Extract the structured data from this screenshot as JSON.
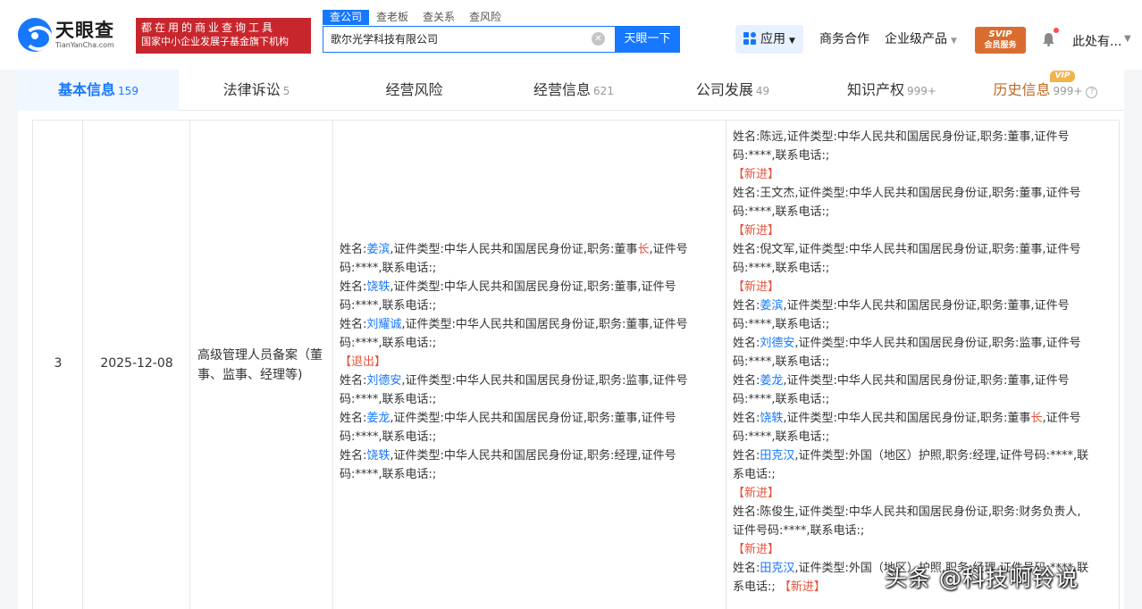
{
  "brand": {
    "name": "天眼查",
    "en": "TianYanCha.com",
    "slogan_1": "都在用的商业查询工具",
    "slogan_2": "国家中小企业发展子基金旗下机构"
  },
  "search": {
    "tabs": [
      "查公司",
      "查老板",
      "查关系",
      "查风险"
    ],
    "value": "歌尔光学科技有限公司",
    "button": "天眼一下"
  },
  "topnav": {
    "app": "应用",
    "business": "商务合作",
    "enterprise": "企业级产品",
    "svip_1": "SVIP",
    "svip_2": "会员服务",
    "user": "此处有..."
  },
  "tabs": [
    {
      "label": "基本信息",
      "count": "159"
    },
    {
      "label": "法律诉讼",
      "count": "5"
    },
    {
      "label": "经营风险",
      "count": ""
    },
    {
      "label": "经营信息",
      "count": "621"
    },
    {
      "label": "公司发展",
      "count": "49"
    },
    {
      "label": "知识产权",
      "count": "999+"
    },
    {
      "label": "历史信息",
      "count": "999+",
      "badge": "VIP"
    }
  ],
  "row": {
    "index": "3",
    "date": "2025-12-08",
    "type": "高级管理人员备案（董事、监事、经理等)"
  },
  "before": {
    "lines": [
      {
        "a": "姓名:",
        "n": "姜滨",
        "b": ",证件类型:中华人民共和国居民身份证,职务:董事",
        "h": "长",
        "c": ",证件号"
      },
      {
        "a": "码:****,联系电话:;",
        "n": "",
        "b": "",
        "h": "",
        "c": ""
      },
      {
        "a": "姓名:",
        "n": "饶轶",
        "b": ",证件类型:中华人民共和国居民身份证,职务:董事,证件号",
        "h": "",
        "c": ""
      },
      {
        "a": "码:****,联系电话:;",
        "n": "",
        "b": "",
        "h": "",
        "c": ""
      },
      {
        "a": "姓名:",
        "n": "刘耀诚",
        "b": ",证件类型:中华人民共和国居民身份证,职务:董事,证件号",
        "h": "",
        "c": ""
      },
      {
        "a": "码:****,联系电话:;",
        "n": "",
        "b": "",
        "h": "",
        "c": ""
      },
      {
        "tag": "【退出】"
      },
      {
        "a": "姓名:",
        "n": "刘德安",
        "b": ",证件类型:中华人民共和国居民身份证,职务:监事,证件号",
        "h": "",
        "c": ""
      },
      {
        "a": "码:****,联系电话:;",
        "n": "",
        "b": "",
        "h": "",
        "c": ""
      },
      {
        "a": "姓名:",
        "n": "姜龙",
        "b": ",证件类型:中华人民共和国居民身份证,职务:董事,证件号",
        "h": "",
        "c": ""
      },
      {
        "a": "码:****,联系电话:;",
        "n": "",
        "b": "",
        "h": "",
        "c": ""
      },
      {
        "a": "姓名:",
        "n": "饶轶",
        "b": ",证件类型:中华人民共和国居民身份证,职务:经理,证件号",
        "h": "",
        "c": ""
      },
      {
        "a": "码:****,联系电话:;",
        "n": "",
        "b": "",
        "h": "",
        "c": ""
      }
    ]
  },
  "after": {
    "lines": [
      {
        "a": "姓名:陈远,证件类型:中华人民共和国居民身份证,职务:董事,证件号",
        "n": "",
        "b": "",
        "h": "",
        "c": ""
      },
      {
        "a": "码:****,联系电话:;",
        "n": "",
        "b": "",
        "h": "",
        "c": ""
      },
      {
        "tag": "【新进】"
      },
      {
        "a": "姓名:王文杰,证件类型:中华人民共和国居民身份证,职务:董事,证件号",
        "n": "",
        "b": "",
        "h": "",
        "c": ""
      },
      {
        "a": "码:****,联系电话:;",
        "n": "",
        "b": "",
        "h": "",
        "c": ""
      },
      {
        "tag": "【新进】"
      },
      {
        "a": "姓名:倪文军,证件类型:中华人民共和国居民身份证,职务:董事,证件号",
        "n": "",
        "b": "",
        "h": "",
        "c": ""
      },
      {
        "a": "码:****,联系电话:;",
        "n": "",
        "b": "",
        "h": "",
        "c": ""
      },
      {
        "tag": "【新进】"
      },
      {
        "a": "姓名:",
        "n": "姜滨",
        "b": ",证件类型:中华人民共和国居民身份证,职务:董事,证件号",
        "h": "",
        "c": ""
      },
      {
        "a": "码:****,联系电话:;",
        "n": "",
        "b": "",
        "h": "",
        "c": ""
      },
      {
        "a": "姓名:",
        "n": "刘德安",
        "b": ",证件类型:中华人民共和国居民身份证,职务:监事,证件号",
        "h": "",
        "c": ""
      },
      {
        "a": "码:****,联系电话:;",
        "n": "",
        "b": "",
        "h": "",
        "c": ""
      },
      {
        "a": "姓名:",
        "n": "姜龙",
        "b": ",证件类型:中华人民共和国居民身份证,职务:董事,证件号",
        "h": "",
        "c": ""
      },
      {
        "a": "码:****,联系电话:;",
        "n": "",
        "b": "",
        "h": "",
        "c": ""
      },
      {
        "a": "姓名:",
        "n": "饶轶",
        "b": ",证件类型:中华人民共和国居民身份证,职务:董事",
        "h": "长",
        "c": ",证件号"
      },
      {
        "a": "码:****,联系电话:;",
        "n": "",
        "b": "",
        "h": "",
        "c": ""
      },
      {
        "a": "姓名:",
        "n": "田克汉",
        "b": ",证件类型:外国（地区）护照,职务:经理,证件号码:****,联",
        "h": "",
        "c": ""
      },
      {
        "a": "系电话:;",
        "n": "",
        "b": "",
        "h": "",
        "c": ""
      },
      {
        "tag": "【新进】"
      },
      {
        "a": "姓名:陈俊生,证件类型:中华人民共和国居民身份证,职务:财务负责人,",
        "n": "",
        "b": "",
        "h": "",
        "c": ""
      },
      {
        "a": "证件号码:****,联系电话:;",
        "n": "",
        "b": "",
        "h": "",
        "c": ""
      },
      {
        "tag": "【新进】"
      },
      {
        "a": "姓名:",
        "n": "田克汉",
        "b": ",证件类型:外国（地区）护照,职务:经理,证件号码:****,联",
        "h": "",
        "c": ""
      },
      {
        "a": "系电话:;",
        "n": "",
        "b": "",
        "h": "",
        "c": "",
        "tail": "【新进】"
      }
    ]
  },
  "watermark": "头条 @科技啊铃说"
}
